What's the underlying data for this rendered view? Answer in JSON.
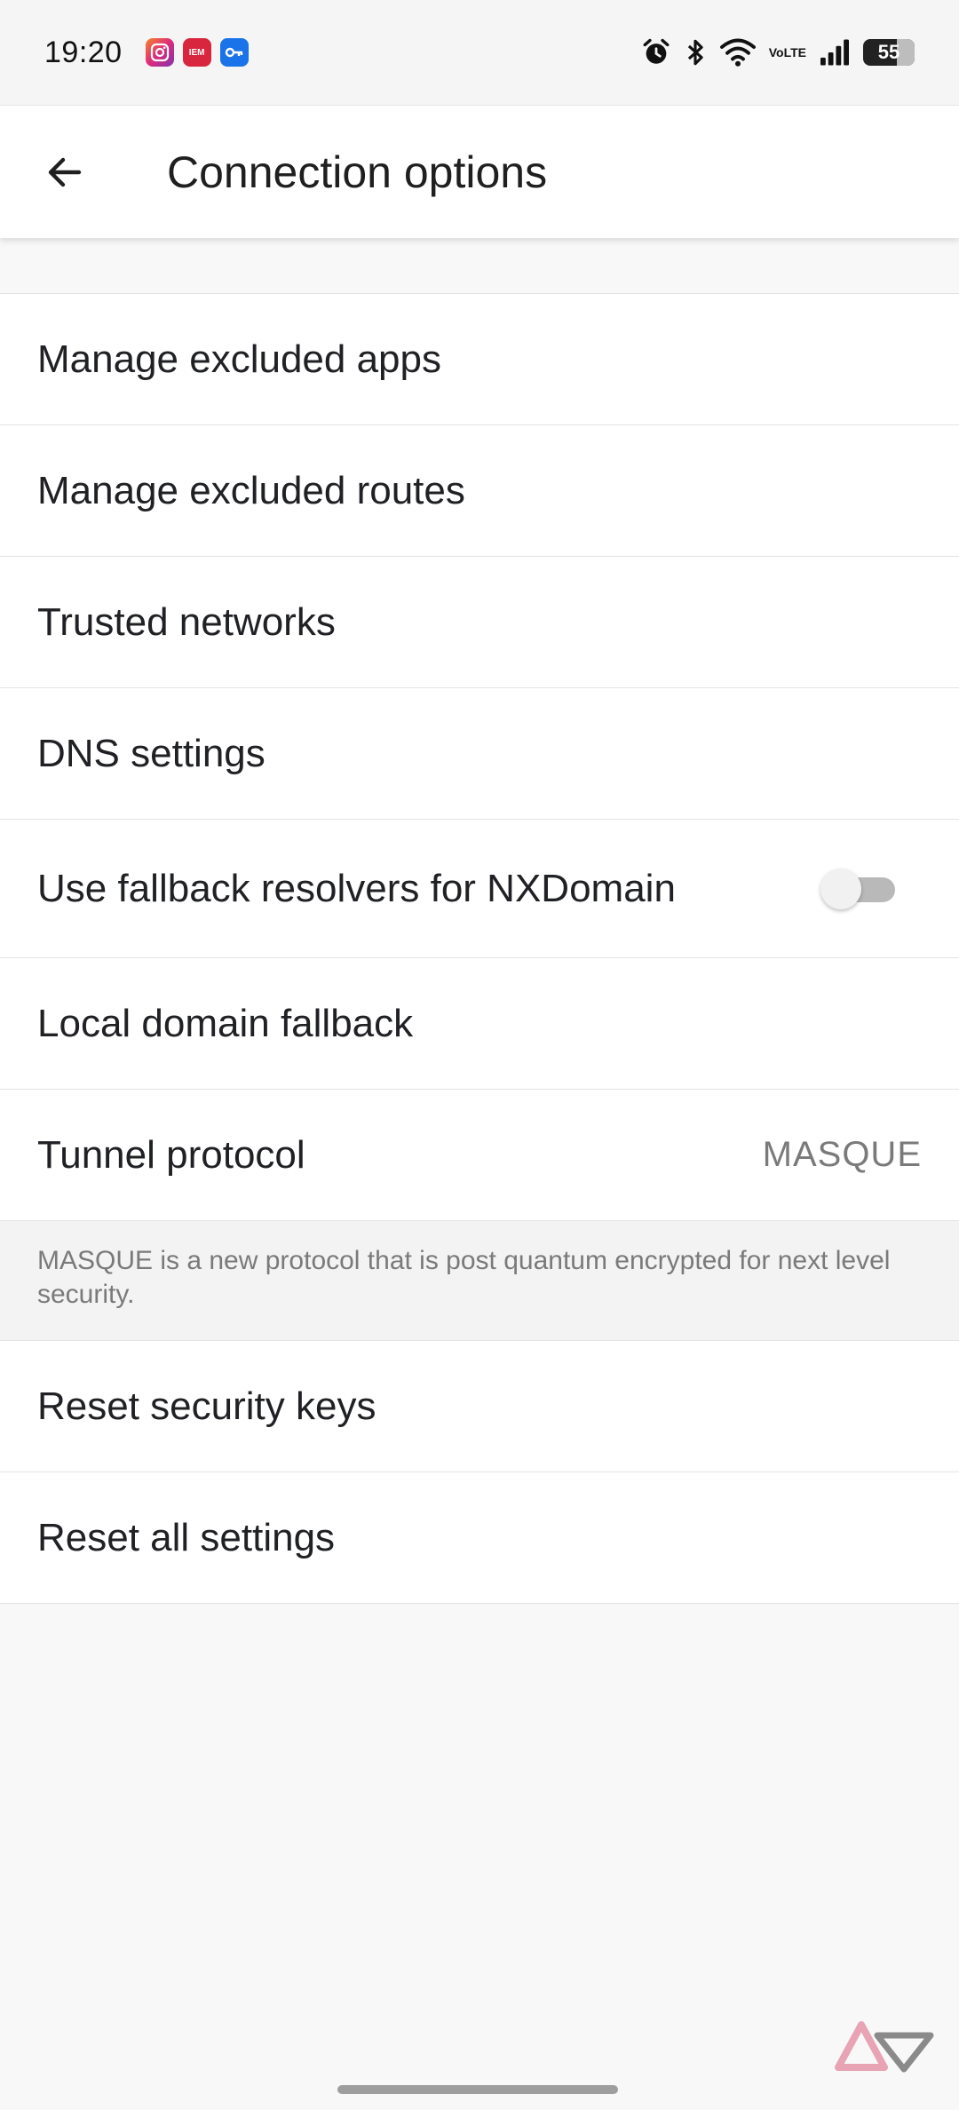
{
  "status_bar": {
    "time": "19:20",
    "notification_icons": [
      "instagram-icon",
      "iem-app-icon",
      "vpn-key-icon"
    ],
    "iem_label": "IEM",
    "volte_label_top": "Vo",
    "volte_label_bottom": "LTE",
    "battery_level": "55",
    "system_icons": [
      "alarm-icon",
      "bluetooth-icon",
      "wifi-icon",
      "volte-icon",
      "signal-icon",
      "battery-icon"
    ]
  },
  "app_bar": {
    "title": "Connection options"
  },
  "settings": {
    "manage_excluded_apps": "Manage excluded apps",
    "manage_excluded_routes": "Manage excluded routes",
    "trusted_networks": "Trusted networks",
    "dns_settings": "DNS settings",
    "fallback_resolvers": "Use fallback resolvers for NXDomain",
    "fallback_resolvers_enabled": false,
    "local_domain_fallback": "Local domain fallback",
    "tunnel_protocol": "Tunnel protocol",
    "tunnel_protocol_value": "MASQUE",
    "tunnel_protocol_note": "MASQUE is a new protocol that is post quantum encrypted for next level security.",
    "reset_security_keys": "Reset security keys",
    "reset_all_settings": "Reset all settings"
  },
  "colors": {
    "background": "#f8f8f8",
    "surface": "#ffffff",
    "text_primary": "#202124",
    "text_secondary": "#7a7a7a",
    "toggle_off_track": "#b9b9b9"
  }
}
